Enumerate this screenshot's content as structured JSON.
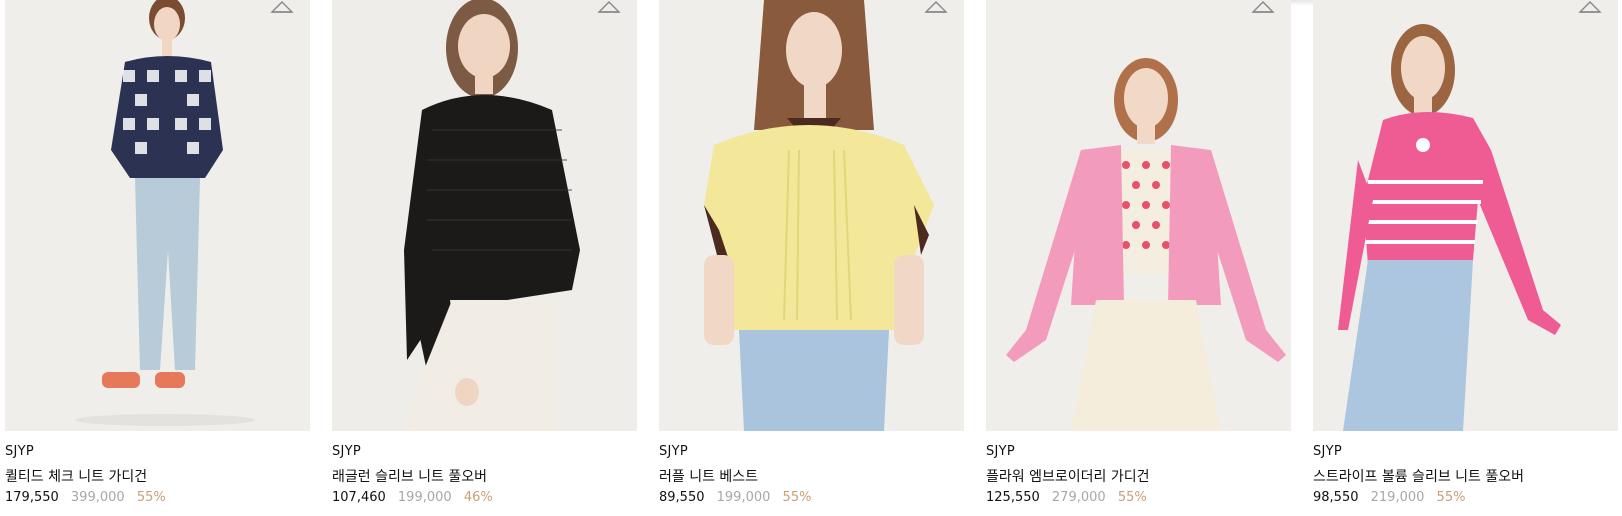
{
  "products": [
    {
      "brand": "SJYP",
      "name": "퀼티드 체크 니트 가디건",
      "price": "179,550",
      "original_price": "399,000",
      "discount": "55%",
      "bg": "#efeeeb",
      "garment_color": "#2c3352",
      "pants_color": "#b7cbd8"
    },
    {
      "brand": "SJYP",
      "name": "래글런 슬리브 니트 풀오버",
      "price": "107,460",
      "original_price": "199,000",
      "discount": "46%",
      "bg": "#efede9",
      "garment_color": "#1b1a19",
      "pants_color": "#f1ede4"
    },
    {
      "brand": "SJYP",
      "name": "러플 니트 베스트",
      "price": "89,550",
      "original_price": "199,000",
      "discount": "55%",
      "bg": "#efeeea",
      "garment_color": "#f3e79a",
      "pants_color": "#a9c4dc"
    },
    {
      "brand": "SJYP",
      "name": "플라워 엠브로이더리 가디건",
      "price": "125,550",
      "original_price": "279,000",
      "discount": "55%",
      "bg": "#efeeeb",
      "garment_color": "#f39bbd",
      "pants_color": "#f5eddc"
    },
    {
      "brand": "SJYP",
      "name": "스트라이프 볼륨 슬리브 니트 풀오버",
      "price": "98,550",
      "original_price": "219,000",
      "discount": "55%",
      "bg": "#efeeeb",
      "garment_color": "#ef5b93",
      "pants_color": "#abc6de"
    }
  ],
  "icons": {
    "wishlist": "wishlist-icon"
  }
}
